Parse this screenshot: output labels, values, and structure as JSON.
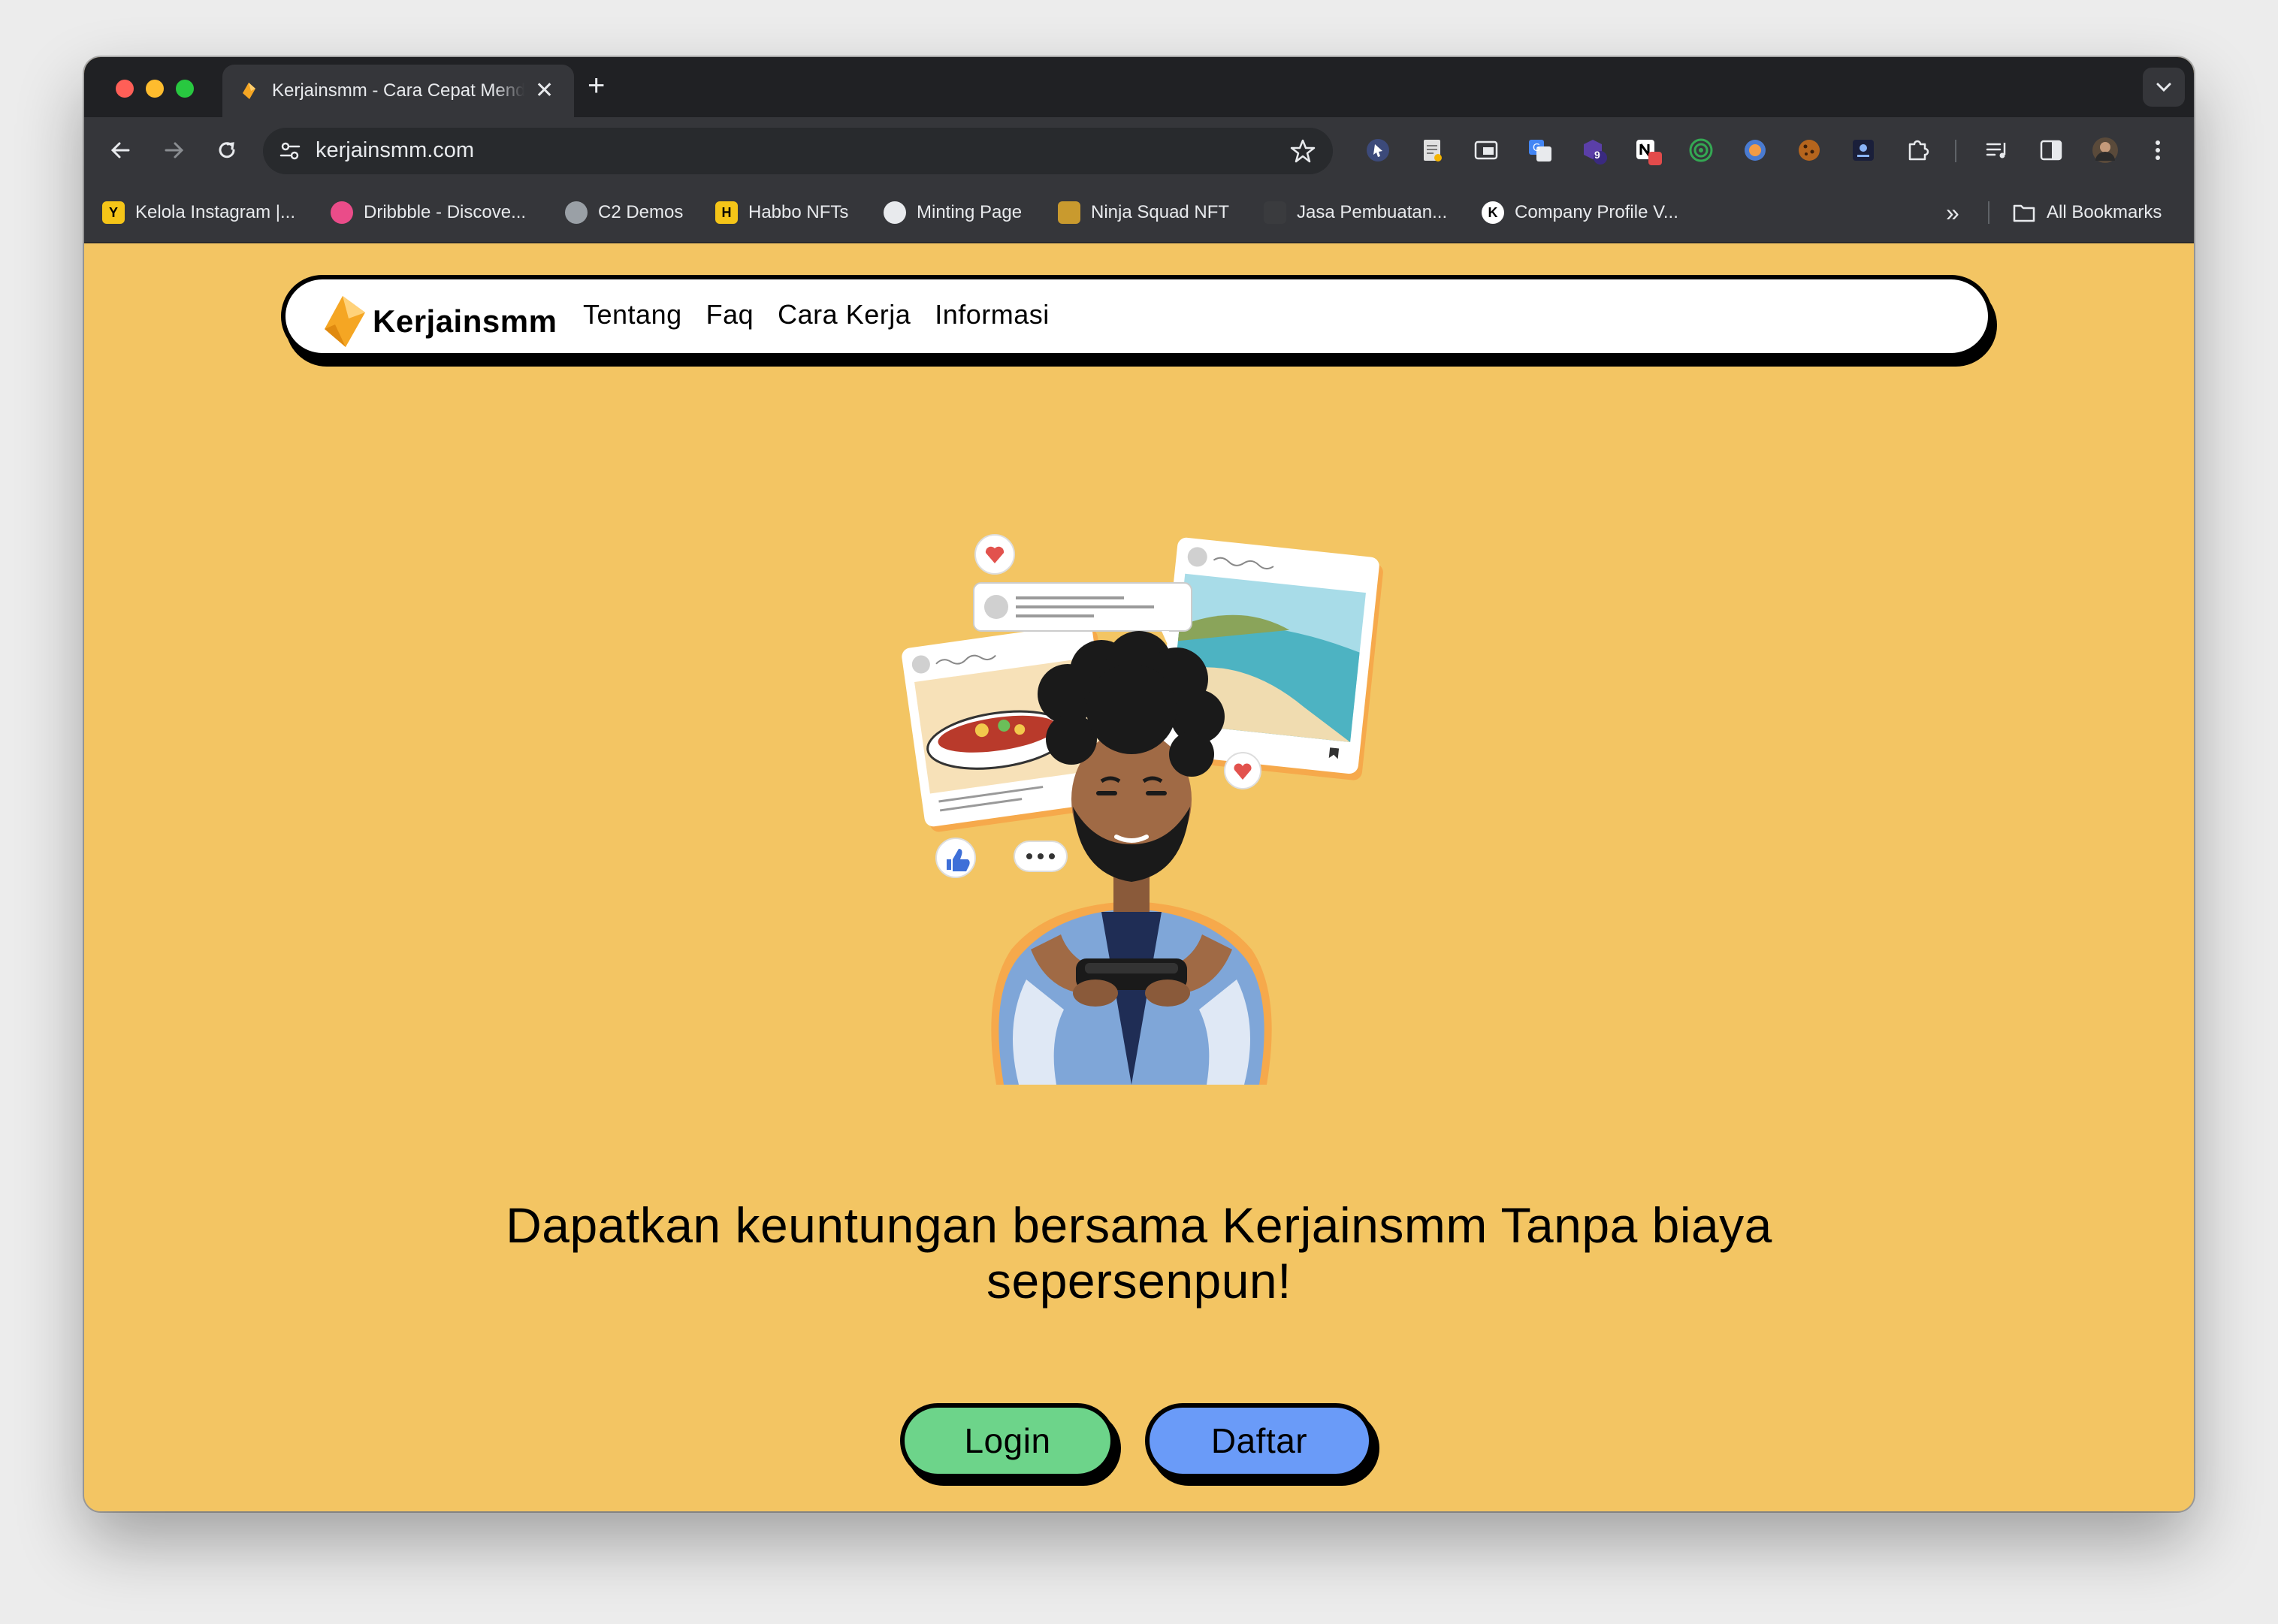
{
  "browser": {
    "tab": {
      "title": "Kerjainsmm - Cara Cepat Mendapatkan Uang",
      "close_glyph": "✕"
    },
    "new_tab_glyph": "+",
    "address": {
      "url": "kerjainsmm.com"
    },
    "bookmarks": [
      {
        "label": "Kelola Instagram |...",
        "icon": "Y"
      },
      {
        "label": "Dribbble - Discove...",
        "icon": ""
      },
      {
        "label": "C2 Demos",
        "icon": ""
      },
      {
        "label": "Habbo NFTs",
        "icon": "H"
      },
      {
        "label": "Minting Page",
        "icon": ""
      },
      {
        "label": "Ninja Squad NFT",
        "icon": ""
      },
      {
        "label": "Jasa Pembuatan...",
        "icon": ""
      },
      {
        "label": "Company Profile V...",
        "icon": "K"
      }
    ],
    "bookmarks_overflow": "»",
    "all_bookmarks": "All Bookmarks",
    "extension_badge": "9"
  },
  "site": {
    "brand": "Kerjainsmm",
    "nav": [
      "Tentang",
      "Faq",
      "Cara Kerja",
      "Informasi"
    ],
    "headline": "Dapatkan keuntungan bersama Kerjainsmm Tanpa biaya sepersenpun!",
    "login_label": "Login",
    "register_label": "Daftar"
  },
  "colors": {
    "page_background": "#f3c563",
    "login_button": "#6dd48a",
    "register_button": "#6a9bf8",
    "brand_accent": "#f5a623"
  }
}
